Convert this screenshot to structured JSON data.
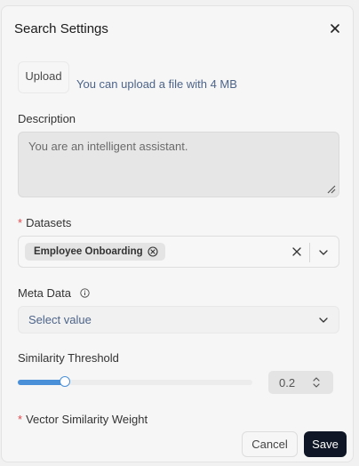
{
  "dialog": {
    "title": "Search Settings"
  },
  "upload": {
    "button_label": "Upload",
    "hint": "You can upload a file with 4 MB"
  },
  "description": {
    "label": "Description",
    "value": "You are an intelligent assistant."
  },
  "datasets": {
    "required_mark": "*",
    "label": "Datasets",
    "selected": [
      "Employee Onboarding"
    ]
  },
  "meta_data": {
    "label": "Meta Data",
    "placeholder": "Select value"
  },
  "similarity_threshold": {
    "label": "Similarity Threshold",
    "value": "0.2",
    "slider_fraction": 0.2
  },
  "vector_similarity_weight": {
    "required_mark": "*",
    "label": "Vector Similarity Weight"
  },
  "footer": {
    "cancel_label": "Cancel",
    "save_label": "Save"
  },
  "icons": {
    "close": "close-icon",
    "chip_remove": "circle-x-icon",
    "clear": "x-icon",
    "chevron": "chevron-down-icon",
    "info": "info-icon",
    "stepper": "chevron-up-down-icon"
  },
  "colors": {
    "accent": "#4a90d9",
    "primary_button": "#0f1726",
    "required": "#e5484d",
    "hint_text": "#4d6489"
  }
}
